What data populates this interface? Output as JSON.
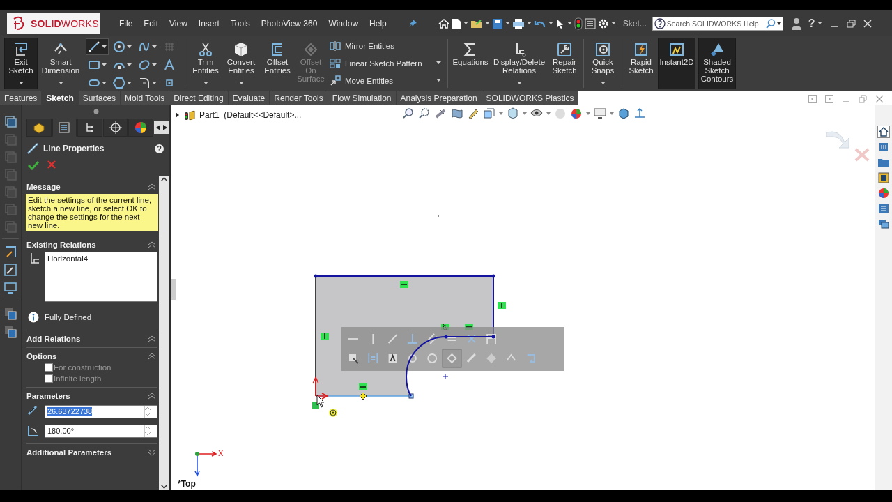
{
  "app": {
    "logo": "**SOLID**WORKS"
  },
  "menu": [
    "File",
    "Edit",
    "View",
    "Insert",
    "Tools",
    "PhotoView 360",
    "Window",
    "Help"
  ],
  "document_label": "Sket...",
  "search": {
    "placeholder": "Search SOLIDWORKS Help"
  },
  "help_glyph": "?",
  "ribbon": [
    {
      "kind": "large",
      "label": "Exit Sketch",
      "pressed": true,
      "disabled": false,
      "dropdown": true
    },
    {
      "kind": "large",
      "label": "Smart Dimension",
      "pressed": false,
      "disabled": false,
      "dropdown": true
    },
    {
      "kind": "tool-grid",
      "tools": [
        {
          "selected": true
        },
        {
          "selected": false
        },
        {
          "selected": false
        },
        {
          "selected": false
        },
        {
          "selected": false
        },
        {
          "selected": false
        },
        {
          "selected": false
        },
        {
          "selected": false
        },
        {
          "selected": false
        },
        {
          "selected": false
        },
        {
          "selected": false
        },
        {
          "selected": false
        }
      ]
    },
    {
      "kind": "separator"
    },
    {
      "kind": "large",
      "label": "Trim Entities",
      "pressed": false,
      "disabled": false,
      "dropdown": true
    },
    {
      "kind": "large",
      "label": "Convert Entities",
      "pressed": false,
      "disabled": false,
      "dropdown": true
    },
    {
      "kind": "large",
      "label": "Offset Entities",
      "pressed": false,
      "disabled": false,
      "dropdown": false
    },
    {
      "kind": "large",
      "label": "Offset On Surface",
      "pressed": false,
      "disabled": true,
      "dropdown": false
    },
    {
      "kind": "small-stack",
      "items": [
        {
          "label": "Mirror Entities",
          "dropdown": false
        },
        {
          "label": "Linear Sketch Pattern",
          "dropdown": true
        },
        {
          "label": "Move Entities",
          "dropdown": true
        }
      ]
    },
    {
      "kind": "separator"
    },
    {
      "kind": "large",
      "label": "Equations",
      "pressed": false,
      "disabled": false,
      "dropdown": false
    },
    {
      "kind": "large",
      "label": "Display/Delete Relations",
      "pressed": false,
      "disabled": false,
      "dropdown": true
    },
    {
      "kind": "large",
      "label": "Repair Sketch",
      "pressed": false,
      "disabled": false,
      "dropdown": false
    },
    {
      "kind": "separator"
    },
    {
      "kind": "large",
      "label": "Quick Snaps",
      "pressed": false,
      "disabled": false,
      "dropdown": true
    },
    {
      "kind": "separator"
    },
    {
      "kind": "large",
      "label": "Rapid Sketch",
      "pressed": false,
      "disabled": false,
      "dropdown": false
    },
    {
      "kind": "large",
      "label": "Instant2D",
      "pressed": true,
      "disabled": false,
      "dropdown": false
    },
    {
      "kind": "large",
      "label": "Shaded Sketch Contours",
      "pressed": true,
      "disabled": false,
      "dropdown": false
    }
  ],
  "tabs": [
    {
      "label": "Features",
      "selected": false
    },
    {
      "label": "Sketch",
      "selected": true
    },
    {
      "label": "Surfaces",
      "selected": false
    },
    {
      "label": "Mold Tools",
      "selected": false
    },
    {
      "label": "Direct Editing",
      "selected": false
    },
    {
      "label": "Evaluate",
      "selected": false
    },
    {
      "label": "Render Tools",
      "selected": false
    },
    {
      "label": "Flow Simulation",
      "selected": false
    },
    {
      "label": "Analysis Preparation",
      "selected": false
    },
    {
      "label": "SOLIDWORKS Plastics",
      "selected": false
    }
  ],
  "property_manager": {
    "tabs": [
      {
        "selected": false
      },
      {
        "selected": true
      },
      {
        "selected": false
      },
      {
        "selected": false
      },
      {
        "selected": false
      }
    ],
    "title": "Line Properties",
    "help_glyph": "?",
    "message": {
      "title": "Message",
      "expanded": true,
      "text": "Edit the settings of the current line, sketch a new line, or select OK to change the settings for the next new line."
    },
    "existing_relations": {
      "title": "Existing Relations",
      "expanded": true,
      "items": [
        "Horizontal4"
      ],
      "status": "Fully Defined"
    },
    "add_relations": {
      "title": "Add Relations",
      "expanded": true
    },
    "options": {
      "title": "Options",
      "expanded": true,
      "checkboxes": [
        {
          "label": "For construction",
          "checked": false,
          "disabled": true
        },
        {
          "label": "Infinite length",
          "checked": false,
          "disabled": true
        }
      ]
    },
    "parameters": {
      "title": "Parameters",
      "expanded": true,
      "fields": [
        {
          "value": "26.63722738",
          "selected": true
        },
        {
          "value": "180.00°",
          "selected": false
        }
      ]
    },
    "additional_parameters": {
      "title": "Additional Parameters",
      "expanded": false
    }
  },
  "viewport": {
    "tree_item": {
      "label": "Part1  (Default<<Default>...",
      "expanded": false
    },
    "triad_label": "X",
    "view_name": "*Top"
  }
}
